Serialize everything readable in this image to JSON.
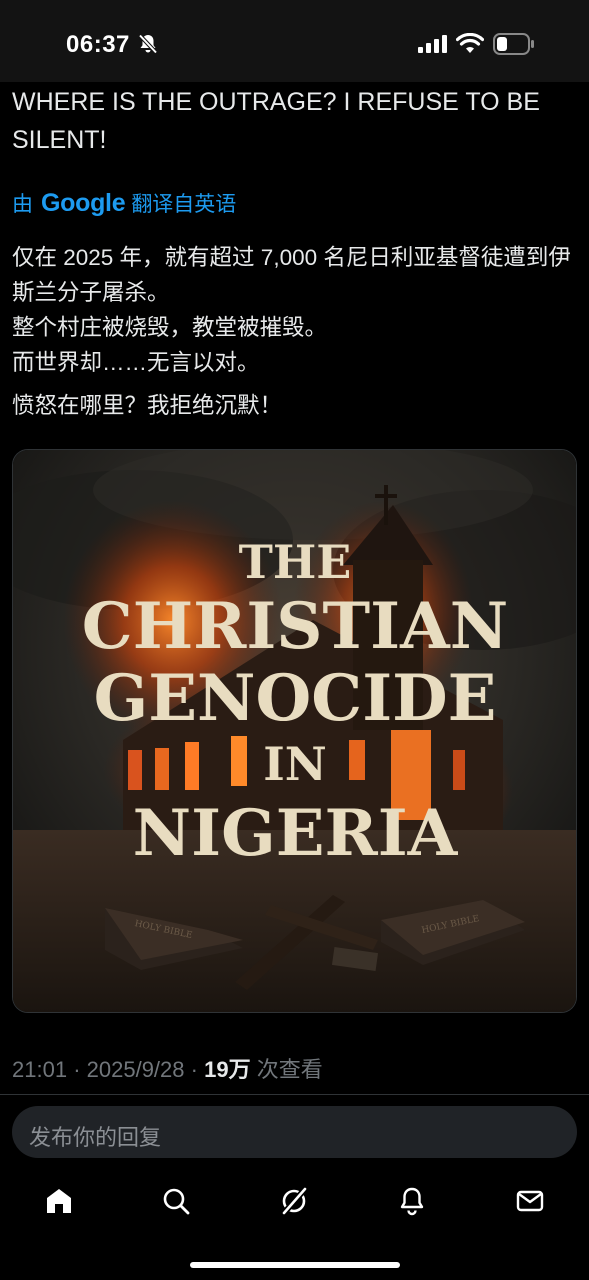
{
  "status": {
    "time": "06:37"
  },
  "post": {
    "english_text": "WHERE IS THE OUTRAGE? I REFUSE TO BE SILENT!",
    "translate_prefix": "由",
    "translate_brand": "Google",
    "translate_suffix": "翻译自英语",
    "zh_lines": [
      "仅在 2025 年，就有超过 7,000 名尼日利亚基督徒遭到伊斯兰分子屠杀。",
      "整个村庄被烧毁，教堂被摧毁。",
      "而世界却……无言以对。"
    ],
    "zh_last": "愤怒在哪里？我拒绝沉默！",
    "image": {
      "title_lines": [
        "THE",
        "CHRISTIAN",
        "GENOCIDE",
        "IN",
        "NIGERIA"
      ],
      "book_left_text": "HOLY BIBLE",
      "book_right_text": "HOLY BIBLE"
    },
    "meta_time": "21:01",
    "meta_sep": "·",
    "meta_date": "2025/9/28",
    "meta_views": "19万",
    "meta_views_label": "次查看"
  },
  "reply": {
    "placeholder": "发布你的回复"
  },
  "tabs": {
    "icons": [
      "home-icon",
      "search-icon",
      "grok-icon",
      "notifications-icon",
      "messages-icon"
    ]
  }
}
